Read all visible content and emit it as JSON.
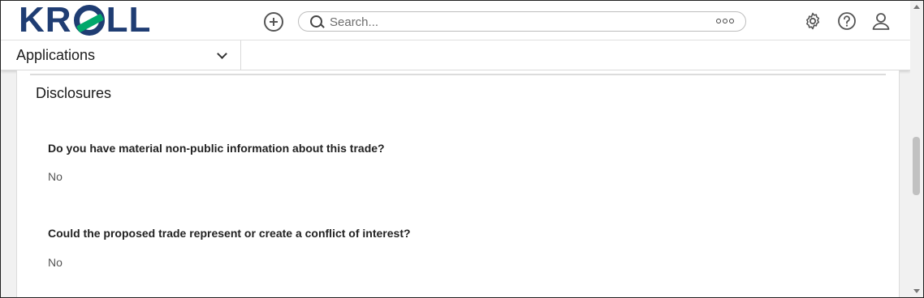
{
  "brand": {
    "logo_text_pre": "KR",
    "logo_text_post": "LL",
    "logo_colors": {
      "primary": "#1f3d73",
      "accent": "#00a86b"
    }
  },
  "header": {
    "add_icon": "plus-circle-icon",
    "search": {
      "placeholder": "Search...",
      "options_icon": "more-options-icon"
    },
    "icons": [
      "gear-icon",
      "help-icon",
      "user-icon"
    ]
  },
  "appbar": {
    "selected": "Applications"
  },
  "content": {
    "section_title": "Disclosures",
    "items": [
      {
        "question": "Do you have material non-public information about this trade?",
        "answer": "No"
      },
      {
        "question": "Could the proposed trade represent or create a conflict of interest?",
        "answer": "No"
      }
    ]
  }
}
